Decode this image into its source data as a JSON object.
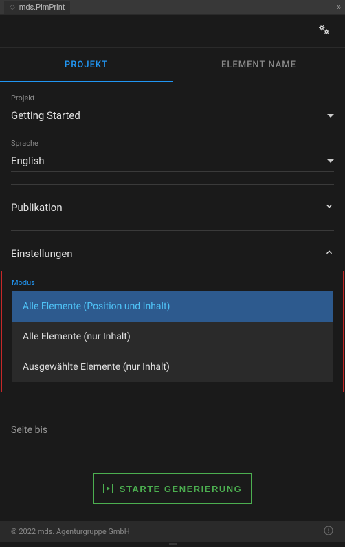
{
  "titleBar": {
    "title": "mds.PimPrint"
  },
  "tabs": {
    "projekt": "PROJEKT",
    "elementName": "ELEMENT NAME"
  },
  "fields": {
    "projekt": {
      "label": "Projekt",
      "value": "Getting Started"
    },
    "sprache": {
      "label": "Sprache",
      "value": "English"
    }
  },
  "sections": {
    "publikation": "Publikation",
    "einstellungen": "Einstellungen"
  },
  "modus": {
    "label": "Modus",
    "options": [
      "Alle Elemente (Position und Inhalt)",
      "Alle Elemente (nur Inhalt)",
      "Ausgewählte Elemente (nur Inhalt)"
    ]
  },
  "inputs": {
    "seiteBis": "Seite bis"
  },
  "buttons": {
    "generate": "STARTE GENERIERUNG"
  },
  "footer": {
    "copyright": "© 2022 mds. Agenturgruppe GmbH"
  }
}
